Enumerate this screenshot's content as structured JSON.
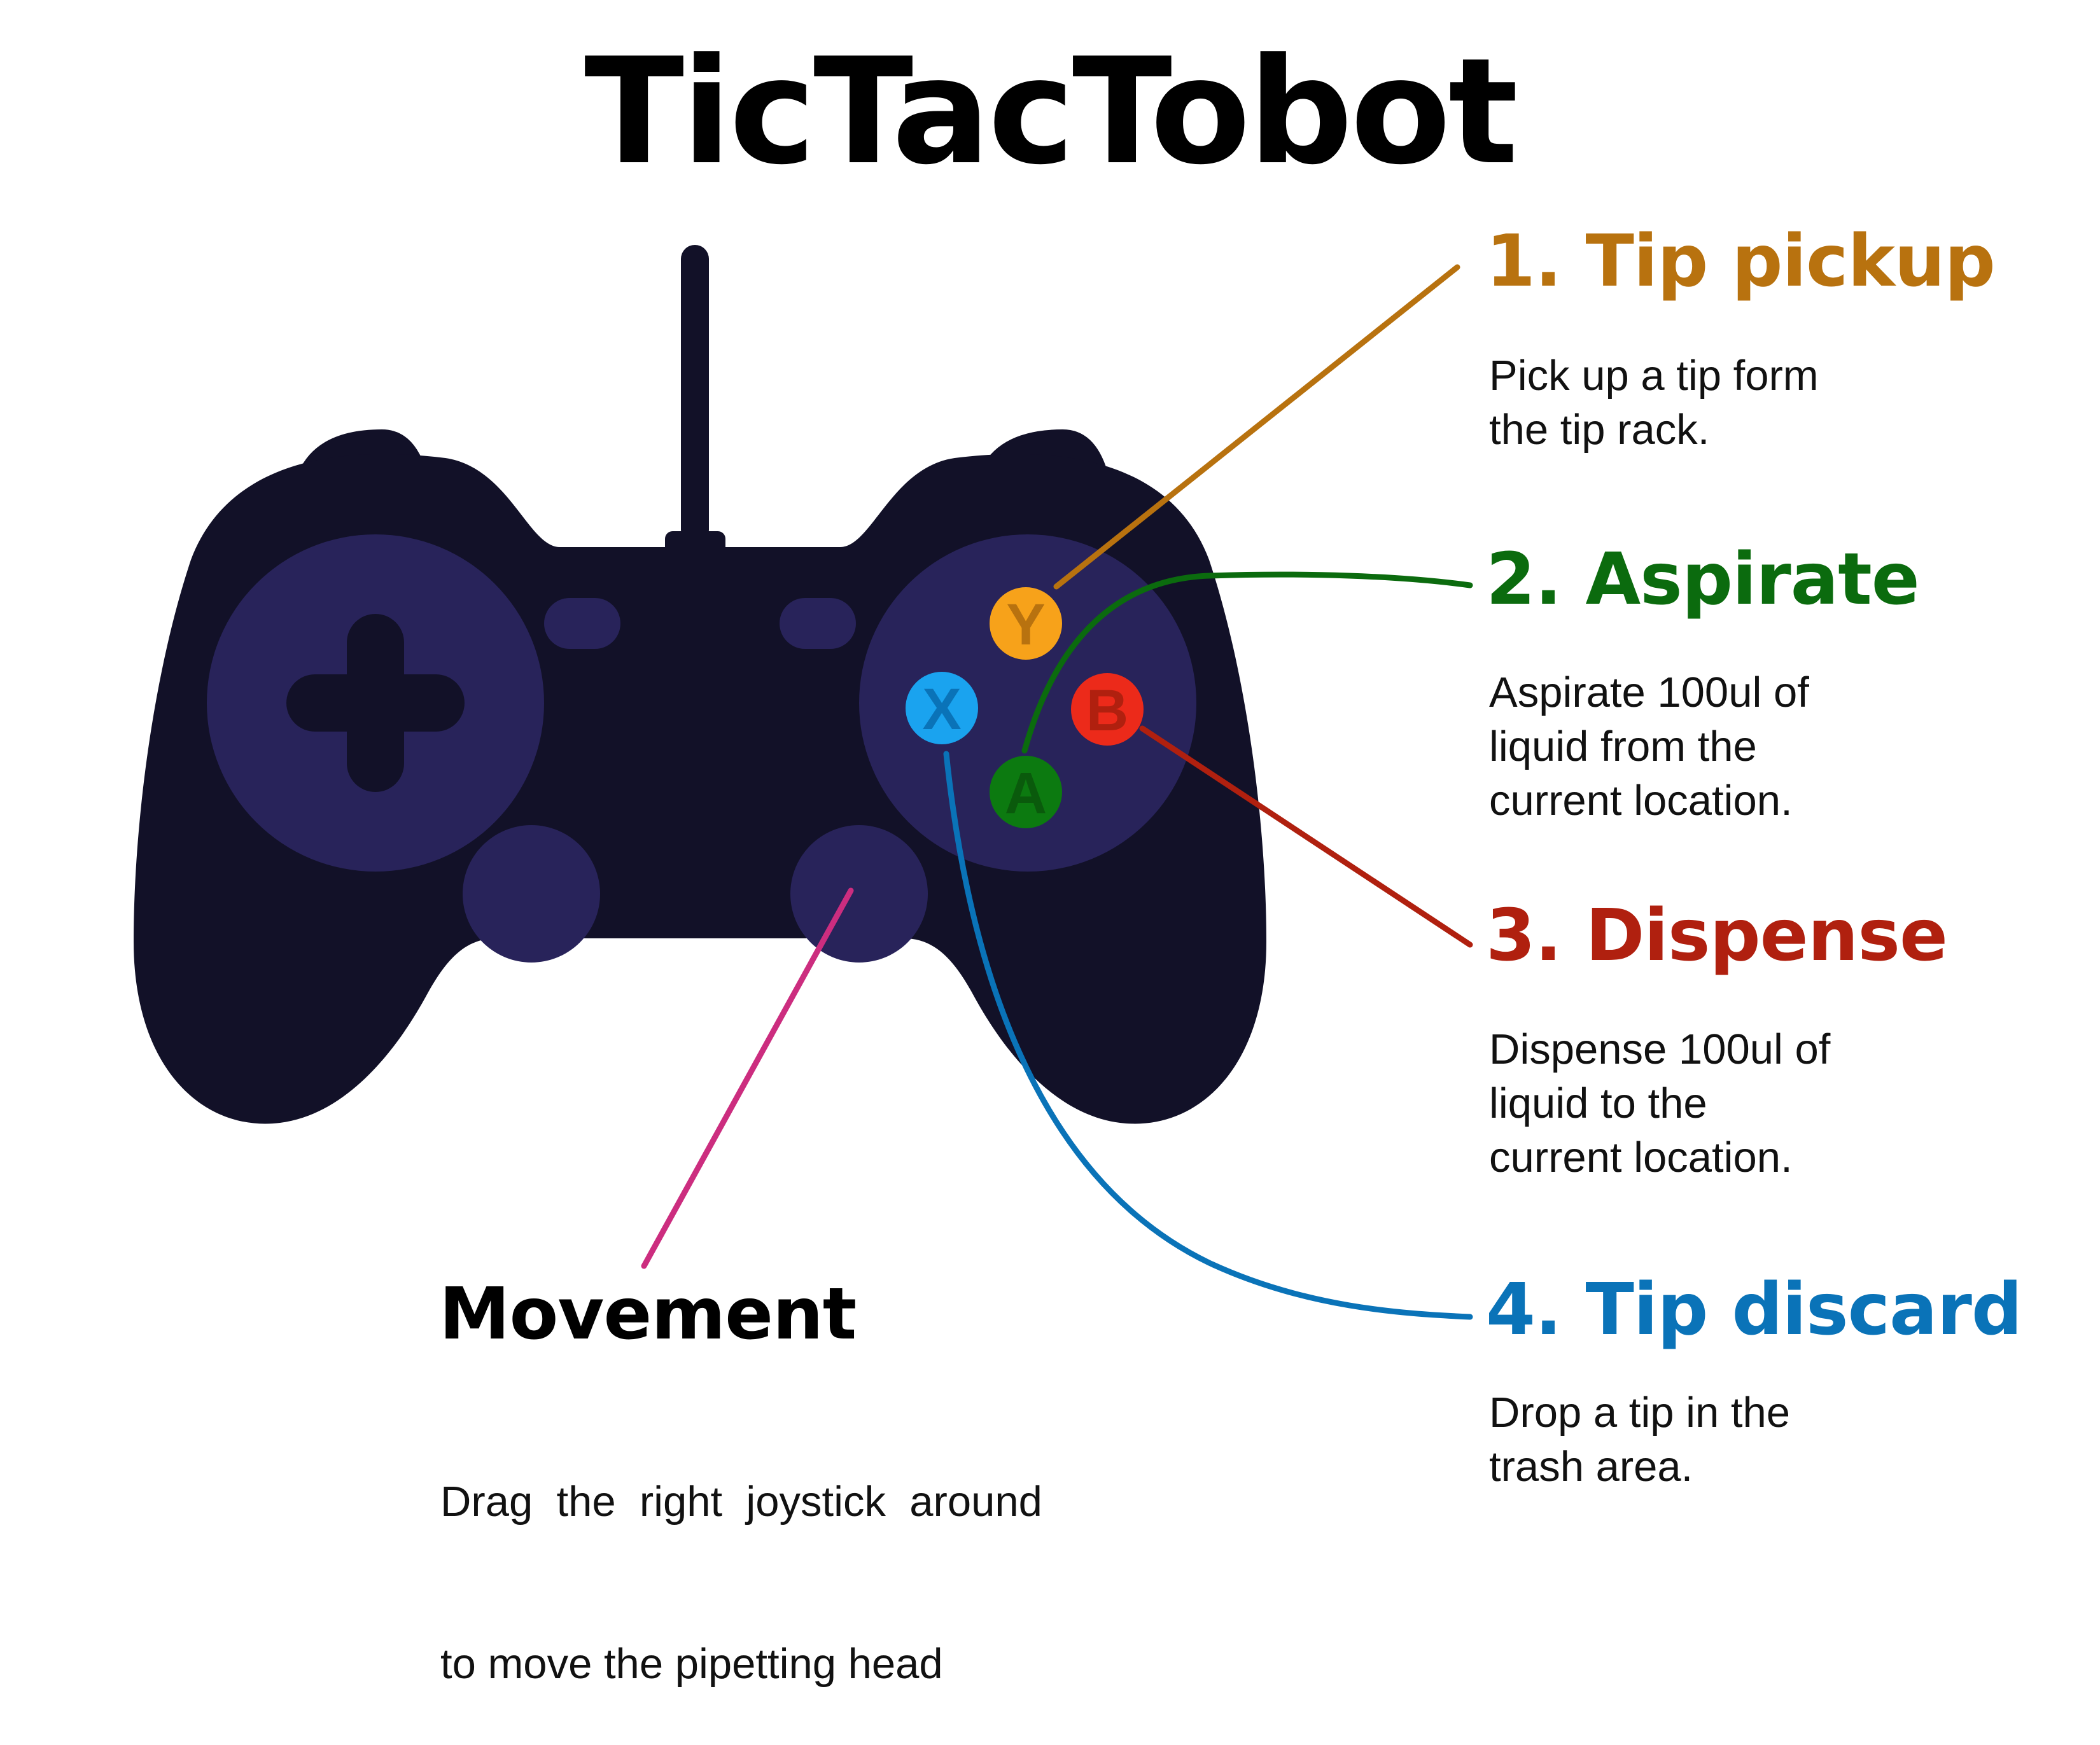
{
  "title": "TicTacTobot",
  "colors": {
    "tip_pickup": "#b8720f",
    "aspirate": "#0b6b0e",
    "dispense": "#b0200f",
    "tip_discard": "#0a73b8",
    "movement_line": "#cc2d7f",
    "controller_body": "#121128",
    "controller_pads": "#28235a",
    "button_y": "#f7a21a",
    "button_x": "#1aa3ef",
    "button_b": "#ec2a1a",
    "button_a": "#0c7a10"
  },
  "buttons": {
    "y": "Y",
    "x": "X",
    "b": "B",
    "a": "A"
  },
  "actions": [
    {
      "heading": "1. Tip pickup",
      "lines": [
        "Pick up a tip form",
        "the tip rack."
      ]
    },
    {
      "heading": "2. Aspirate",
      "lines": [
        "Aspirate 100ul of",
        "liquid from the",
        "current location."
      ]
    },
    {
      "heading": "3. Dispense",
      "lines": [
        "Dispense 100ul of",
        "liquid to the",
        "current location."
      ]
    },
    {
      "heading": "4. Tip discard",
      "lines": [
        "Drop a tip in the",
        "trash area."
      ]
    }
  ],
  "movement": {
    "heading": "Movement",
    "lines": [
      "Drag  the  right  joystick  around",
      "to move the pipetting head"
    ]
  },
  "icons": {
    "controller": "gamepad-icon",
    "dpad": "dpad-icon",
    "cable": "cable-icon"
  }
}
